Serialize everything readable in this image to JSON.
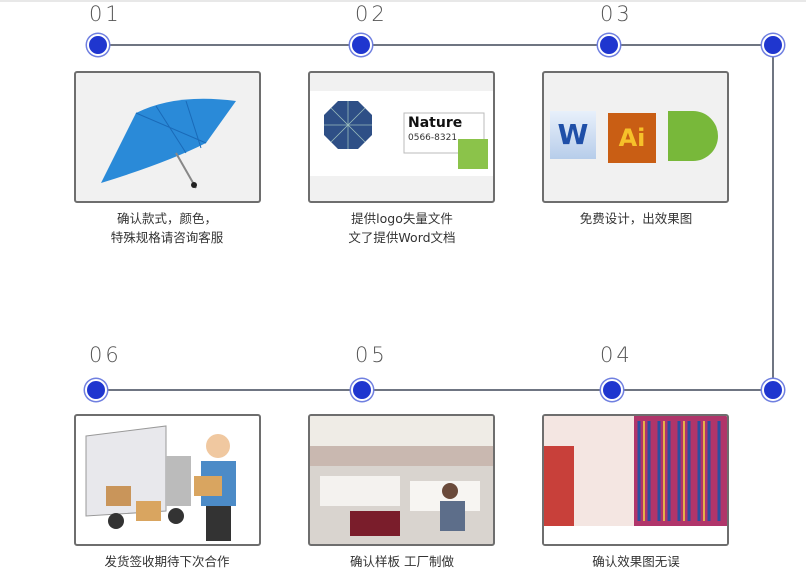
{
  "steps": [
    {
      "number": "01",
      "caption_line1": "确认款式，颜色，",
      "caption_line2": "特殊规格请咨询客服",
      "image": "blue-umbrella"
    },
    {
      "number": "02",
      "caption_line1": "提供logo失量文件",
      "caption_line2": "文了提供Word文档",
      "image": "logo-design-sample",
      "logo_text": "Nature",
      "phone_text": "0566-8321"
    },
    {
      "number": "03",
      "caption_line1": "免费设计，出效果图",
      "image": "design-software-icons",
      "icons": [
        "W",
        "Ai",
        "corel"
      ]
    },
    {
      "number": "04",
      "caption_line1": "确认效果图无误",
      "image": "umbrella-showroom"
    },
    {
      "number": "05",
      "caption_line1": "确认样板 工厂制做",
      "image": "factory-workshop"
    },
    {
      "number": "06",
      "caption_line1": "发货签收期待下次合作",
      "image": "delivery-truck"
    }
  ],
  "colors": {
    "dot": "#1f36cf",
    "line": "#6f7582"
  }
}
